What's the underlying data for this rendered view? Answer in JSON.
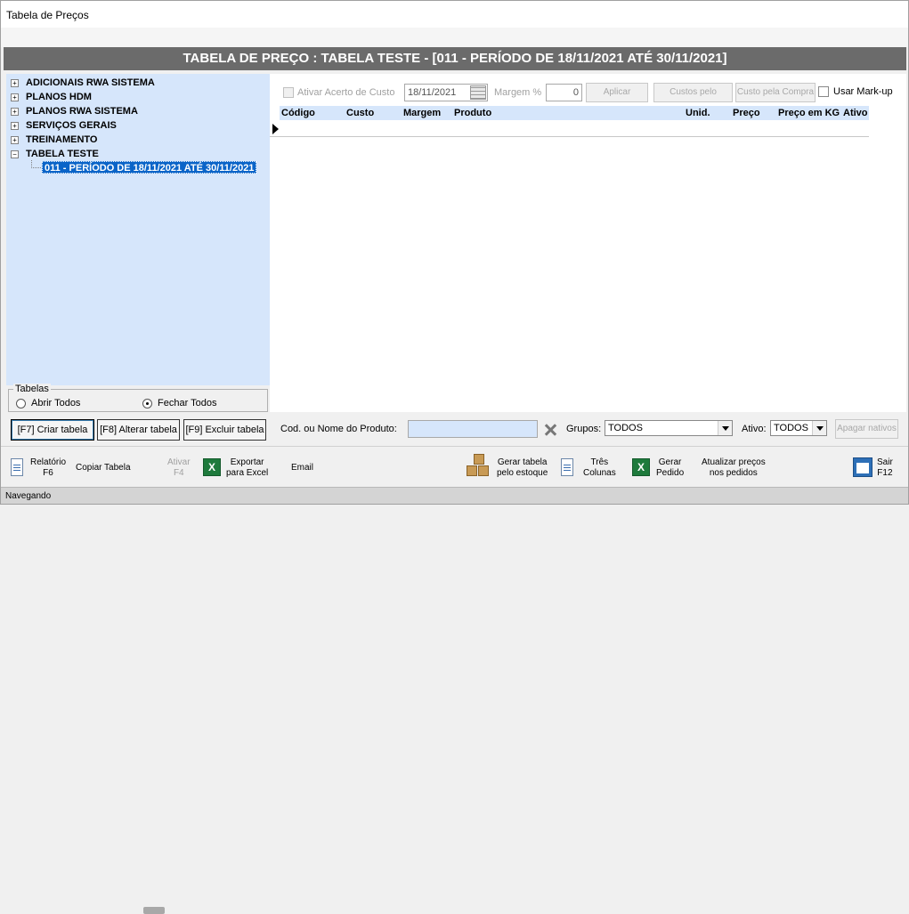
{
  "window": {
    "title": "Tabela de Preços"
  },
  "header": {
    "title": "TABELA DE PREÇO : TABELA TESTE  -  [011 - PERÍODO DE 18/11/2021 ATÉ 30/11/2021]"
  },
  "tree": {
    "items": [
      {
        "label": "ADICIONAIS RWA SISTEMA",
        "expander": "+"
      },
      {
        "label": "PLANOS HDM",
        "expander": "+"
      },
      {
        "label": "PLANOS RWA SISTEMA",
        "expander": "+"
      },
      {
        "label": "SERVIÇOS GERAIS",
        "expander": "+"
      },
      {
        "label": "TREINAMENTO",
        "expander": "+"
      },
      {
        "label": "TABELA TESTE",
        "expander": "−"
      }
    ],
    "selected_child": "011 - PERÍODO DE 18/11/2021 ATÉ 30/11/2021"
  },
  "tabelas_group": {
    "legend": "Tabelas",
    "options": [
      {
        "label": "Abrir Todos",
        "checked": false
      },
      {
        "label": "Fechar Todos",
        "checked": true
      }
    ]
  },
  "left_buttons": {
    "criar": "[F7] Criar tabela",
    "alterar": "[F8] Alterar tabela",
    "excluir": "[F9] Excluir tabela"
  },
  "options_bar": {
    "ativar_acerto_label": "Ativar Acerto de Custo",
    "date_value": "18/11/2021",
    "margem_label": "Margem %",
    "margem_value": "0",
    "aplicar_margem": "Aplicar Margem",
    "custos_estoque": "Custos pelo Estoque",
    "custo_compra": "Custo pela Compra",
    "usar_markup_label": "Usar Mark-up"
  },
  "grid": {
    "columns": [
      "Código",
      "Custo",
      "Margem",
      "Produto",
      "Unid.",
      "Preço",
      "Preço em KG",
      "Ativo"
    ]
  },
  "filter_bar": {
    "produto_label": "Cod. ou Nome do Produto:",
    "produto_value": "",
    "grupos_label": "Grupos:",
    "grupos_value": "TODOS",
    "ativo_label": "Ativo:",
    "ativo_value": "TODOS",
    "apagar_nativos": "Apagar nativos"
  },
  "toolbar": {
    "relatorio": [
      "Relatório",
      "F6"
    ],
    "copiar": "Copiar Tabela",
    "ativar": [
      "Ativar",
      "F4"
    ],
    "exportar": [
      "Exportar",
      "para Excel"
    ],
    "email": "Email",
    "gerar_tabela": [
      "Gerar tabela",
      "pelo estoque"
    ],
    "tres_colunas": [
      "Três",
      "Colunas"
    ],
    "gerar_pedido": [
      "Gerar",
      "Pedido"
    ],
    "atualizar": [
      "Atualizar preços",
      "nos pedidos"
    ],
    "sair": [
      "Sair",
      "F12"
    ]
  },
  "status": {
    "text": "Navegando"
  },
  "colors": {
    "header_bg": "#6b6b6b",
    "panel_bg": "#d6e6fb",
    "selection": "#0a64c8"
  }
}
